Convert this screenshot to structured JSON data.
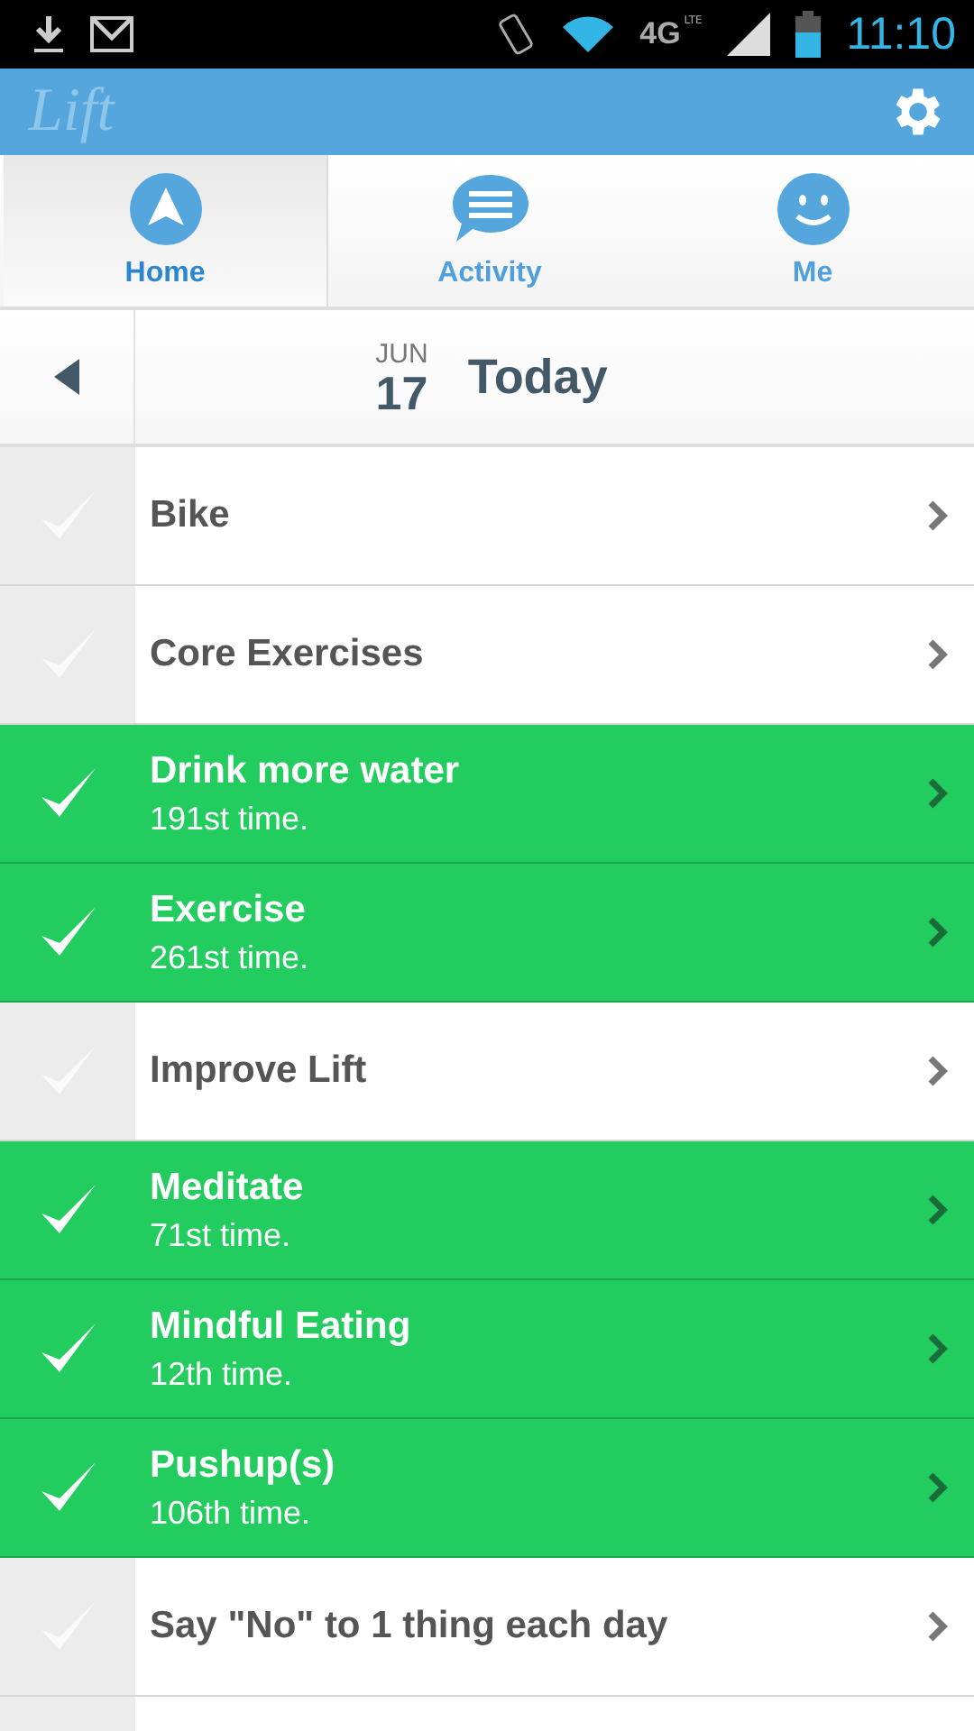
{
  "status_bar": {
    "network": "4G",
    "network_sub": "LTE",
    "time": "11:10"
  },
  "app_bar": {
    "logo": "Lift"
  },
  "tabs": [
    {
      "label": "Home",
      "kind": "home",
      "selected": true
    },
    {
      "label": "Activity",
      "kind": "activity",
      "selected": false
    },
    {
      "label": "Me",
      "kind": "me",
      "selected": false
    }
  ],
  "date_header": {
    "month": "JUN",
    "day": "17",
    "title": "Today"
  },
  "habits": [
    {
      "name": "Bike",
      "checked": false
    },
    {
      "name": "Core Exercises",
      "checked": false
    },
    {
      "name": "Drink more water",
      "checked": true,
      "count": "191st time."
    },
    {
      "name": "Exercise",
      "checked": true,
      "count": "261st time."
    },
    {
      "name": "Improve Lift",
      "checked": false
    },
    {
      "name": "Meditate",
      "checked": true,
      "count": "71st time."
    },
    {
      "name": "Mindful Eating",
      "checked": true,
      "count": "12th time."
    },
    {
      "name": "Pushup(s)",
      "checked": true,
      "count": "106th time."
    },
    {
      "name": "Say \"No\" to 1 thing each day",
      "checked": false
    }
  ]
}
